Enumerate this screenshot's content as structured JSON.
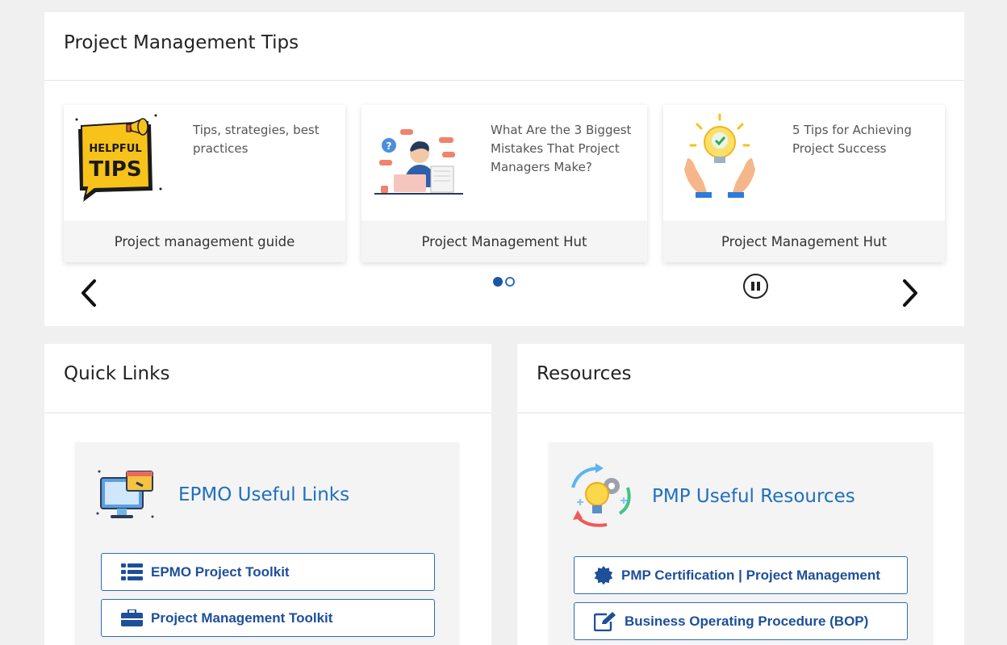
{
  "tips": {
    "title": "Project Management Tips",
    "cards": [
      {
        "text": "Tips, strategies, best practices",
        "footer": "Project management guide",
        "icon": "helpful-tips-icon",
        "badge_line1": "HELPFUL",
        "badge_line2": "TIPS"
      },
      {
        "text": "What Are the 3 Biggest Mistakes That Project Managers Make?",
        "footer": "Project Management Hut",
        "icon": "stressed-manager-icon"
      },
      {
        "text": "5 Tips for Achieving Project Success",
        "footer": "Project Management Hut",
        "icon": "lightbulb-hands-icon"
      }
    ],
    "controls": {
      "prev_icon": "chevron-left-icon",
      "next_icon": "chevron-right-icon",
      "pause_icon": "pause-icon",
      "dot_count": 2,
      "active_dot": 0
    }
  },
  "quick_links": {
    "title": "Quick Links",
    "box_title": "EPMO Useful Links",
    "links": [
      {
        "label": "EPMO Project Toolkit",
        "icon": "list-icon"
      },
      {
        "label": "Project Management Toolkit",
        "icon": "briefcase-icon"
      }
    ]
  },
  "resources": {
    "title": "Resources",
    "box_title": "PMP Useful Resources",
    "links": [
      {
        "label": "PMP Certification | Project Management",
        "icon": "certificate-icon"
      },
      {
        "label": "Business Operating Procedure (BOP)",
        "icon": "edit-icon"
      }
    ]
  },
  "colors": {
    "accent": "#1f6fc0",
    "button_border": "#2b6cb8",
    "button_text": "#1d4f9a",
    "page_bg": "#f0f0f0"
  }
}
